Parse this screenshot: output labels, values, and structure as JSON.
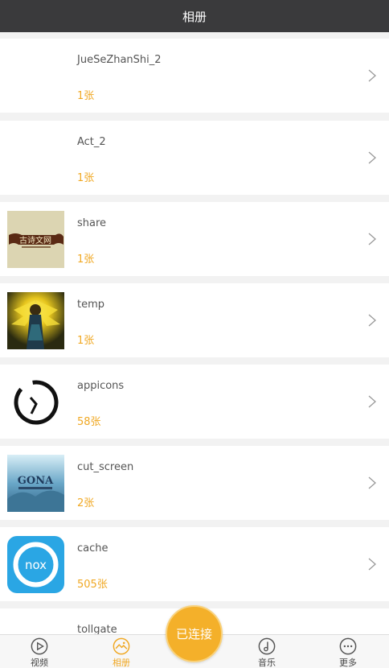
{
  "header": {
    "title": "相册"
  },
  "albums": [
    {
      "name": "JueSeZhanShi_2",
      "count": "1张",
      "thumb": "none"
    },
    {
      "name": "Act_2",
      "count": "1张",
      "thumb": "none"
    },
    {
      "name": "share",
      "count": "1张",
      "thumb": "calligraphy-banner"
    },
    {
      "name": "temp",
      "count": "1张",
      "thumb": "golden-warrior"
    },
    {
      "name": "appicons",
      "count": "58张",
      "thumb": "clock-icon"
    },
    {
      "name": "cut_screen",
      "count": "2张",
      "thumb": "game-poster"
    },
    {
      "name": "cache",
      "count": "505张",
      "thumb": "nox-logo"
    },
    {
      "name": "tollgate",
      "count": "",
      "thumb": "none"
    }
  ],
  "tabs": [
    {
      "label": "视频",
      "icon": "play-icon",
      "active": false
    },
    {
      "label": "相册",
      "icon": "photo-icon",
      "active": true
    },
    {
      "label": "音乐",
      "icon": "music-note-icon",
      "active": false
    },
    {
      "label": "更多",
      "icon": "more-dots-icon",
      "active": false
    }
  ],
  "connect_button": {
    "label": "已连接"
  },
  "colors": {
    "header_bg": "#3a3a3c",
    "accent": "#f0a823",
    "connect_bg": "#f4b02a"
  }
}
